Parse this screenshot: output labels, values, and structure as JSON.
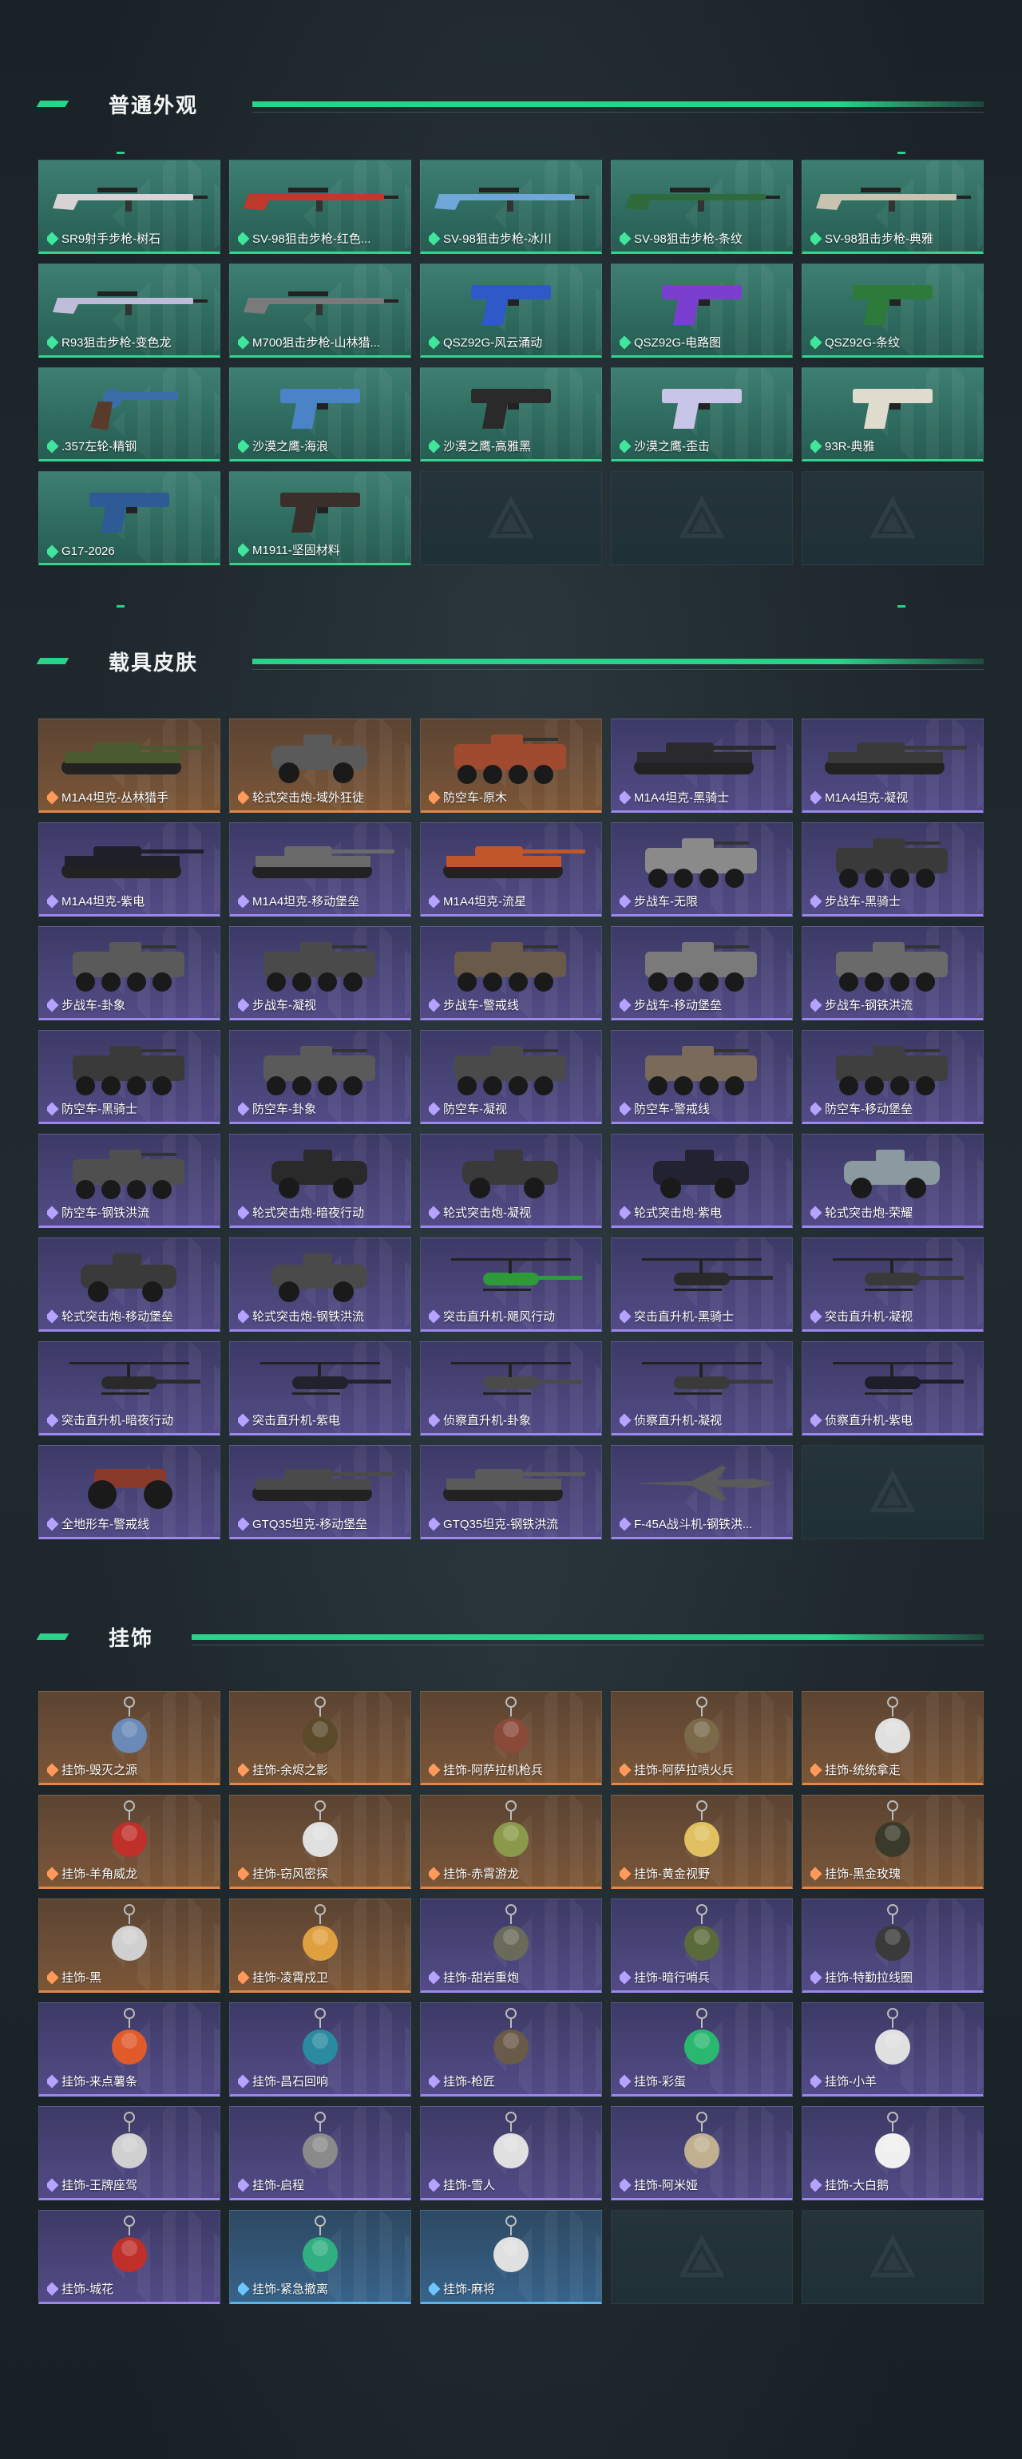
{
  "sections": {
    "appearance": {
      "title": "普通外观",
      "items": [
        {
          "label": "SR9射手步枪-树石",
          "rarity": "green",
          "kind": "rifle",
          "color": "#d9d2d4"
        },
        {
          "label": "SV-98狙击步枪-红色...",
          "rarity": "green",
          "kind": "rifle",
          "color": "#c0392b"
        },
        {
          "label": "SV-98狙击步枪-冰川",
          "rarity": "green",
          "kind": "rifle",
          "color": "#6ea6d8"
        },
        {
          "label": "SV-98狙击步枪-条纹",
          "rarity": "green",
          "kind": "rifle",
          "color": "#2f6b3a"
        },
        {
          "label": "SV-98狙击步枪-典雅",
          "rarity": "green",
          "kind": "rifle",
          "color": "#c9c2b0"
        },
        {
          "label": "R93狙击步枪-变色龙",
          "rarity": "green",
          "kind": "rifle",
          "color": "#bfbcd9"
        },
        {
          "label": "M700狙击步枪-山林猎...",
          "rarity": "green",
          "kind": "rifle",
          "color": "#7a7a7a"
        },
        {
          "label": "QSZ92G-风云涌动",
          "rarity": "green",
          "kind": "pistol",
          "color": "#2f58c8"
        },
        {
          "label": "QSZ92G-电路图",
          "rarity": "green",
          "kind": "pistol",
          "color": "#7b3fd0"
        },
        {
          "label": "QSZ92G-条纹",
          "rarity": "green",
          "kind": "pistol",
          "color": "#2e7a3a"
        },
        {
          "label": ".357左轮-精钢",
          "rarity": "green",
          "kind": "revolver",
          "color": "#3b6ea8"
        },
        {
          "label": "沙漠之鹰-海浪",
          "rarity": "green",
          "kind": "pistol",
          "color": "#4b83c8"
        },
        {
          "label": "沙漠之鹰-高雅黑",
          "rarity": "green",
          "kind": "pistol",
          "color": "#2a2a2a"
        },
        {
          "label": "沙漠之鹰-歪击",
          "rarity": "green",
          "kind": "pistol",
          "color": "#c8c6e8"
        },
        {
          "label": "93R-典雅",
          "rarity": "green",
          "kind": "pistol",
          "color": "#e0dccd"
        },
        {
          "label": "G17-2026",
          "rarity": "green",
          "kind": "pistol",
          "color": "#2e5a96"
        },
        {
          "label": "M1911-坚固材料",
          "rarity": "green",
          "kind": "pistol",
          "color": "#3a2f2a"
        },
        {
          "label": "",
          "rarity": "empty"
        },
        {
          "label": "",
          "rarity": "empty"
        },
        {
          "label": "",
          "rarity": "empty"
        }
      ]
    },
    "vehicles": {
      "title": "载具皮肤",
      "items": [
        {
          "label": "M1A4坦克-丛林猎手",
          "rarity": "orange",
          "kind": "tank",
          "color": "#4c5a32"
        },
        {
          "label": "轮式突击炮-域外狂徒",
          "rarity": "orange",
          "kind": "armored",
          "color": "#5a5a5a"
        },
        {
          "label": "防空车-原木",
          "rarity": "orange",
          "kind": "apc",
          "color": "#a04a30"
        },
        {
          "label": "M1A4坦克-黑骑士",
          "rarity": "purple",
          "kind": "tank",
          "color": "#2a2a2e"
        },
        {
          "label": "M1A4坦克-凝视",
          "rarity": "purple",
          "kind": "tank",
          "color": "#3a3a3a"
        },
        {
          "label": "M1A4坦克-紫电",
          "rarity": "purple",
          "kind": "tank",
          "color": "#1f1f2a"
        },
        {
          "label": "M1A4坦克-移动堡垒",
          "rarity": "purple",
          "kind": "tank",
          "color": "#6a6a6a"
        },
        {
          "label": "M1A4坦克-流星",
          "rarity": "purple",
          "kind": "tank",
          "color": "#c0562a"
        },
        {
          "label": "步战车-无限",
          "rarity": "purple",
          "kind": "apc",
          "color": "#8a8a8a"
        },
        {
          "label": "步战车-黑骑士",
          "rarity": "purple",
          "kind": "apc",
          "color": "#3a3a3a"
        },
        {
          "label": "步战车-卦象",
          "rarity": "purple",
          "kind": "apc",
          "color": "#5a5a5a"
        },
        {
          "label": "步战车-凝视",
          "rarity": "purple",
          "kind": "apc",
          "color": "#4a4a4a"
        },
        {
          "label": "步战车-警戒线",
          "rarity": "purple",
          "kind": "apc",
          "color": "#6a5a4a"
        },
        {
          "label": "步战车-移动堡垒",
          "rarity": "purple",
          "kind": "apc",
          "color": "#7a7a7a"
        },
        {
          "label": "步战车-钢铁洪流",
          "rarity": "purple",
          "kind": "apc",
          "color": "#6a6a6a"
        },
        {
          "label": "防空车-黑骑士",
          "rarity": "purple",
          "kind": "apc",
          "color": "#3a3a3a"
        },
        {
          "label": "防空车-卦象",
          "rarity": "purple",
          "kind": "apc",
          "color": "#5a5a5a"
        },
        {
          "label": "防空车-凝视",
          "rarity": "purple",
          "kind": "apc",
          "color": "#4a4a4a"
        },
        {
          "label": "防空车-警戒线",
          "rarity": "purple",
          "kind": "apc",
          "color": "#7a6a5a"
        },
        {
          "label": "防空车-移动堡垒",
          "rarity": "purple",
          "kind": "apc",
          "color": "#3f3f3f"
        },
        {
          "label": "防空车-钢铁洪流",
          "rarity": "purple",
          "kind": "apc",
          "color": "#4f4f4f"
        },
        {
          "label": "轮式突击炮-暗夜行动",
          "rarity": "purple",
          "kind": "armored",
          "color": "#2a2a2a"
        },
        {
          "label": "轮式突击炮-凝视",
          "rarity": "purple",
          "kind": "armored",
          "color": "#3a3a3a"
        },
        {
          "label": "轮式突击炮-紫电",
          "rarity": "purple",
          "kind": "armored",
          "color": "#222230"
        },
        {
          "label": "轮式突击炮-荣耀",
          "rarity": "purple",
          "kind": "armored",
          "color": "#8a9aa0"
        },
        {
          "label": "轮式突击炮-移动堡垒",
          "rarity": "purple",
          "kind": "armored",
          "color": "#3a3a3a"
        },
        {
          "label": "轮式突击炮-钢铁洪流",
          "rarity": "purple",
          "kind": "armored",
          "color": "#4a4a4a"
        },
        {
          "label": "突击直升机-飓风行动",
          "rarity": "purple",
          "kind": "heli",
          "color": "#2e9a3a"
        },
        {
          "label": "突击直升机-黑骑士",
          "rarity": "purple",
          "kind": "heli",
          "color": "#2a2a2a"
        },
        {
          "label": "突击直升机-凝视",
          "rarity": "purple",
          "kind": "heli",
          "color": "#3a3a3a"
        },
        {
          "label": "突击直升机-暗夜行动",
          "rarity": "purple",
          "kind": "heli",
          "color": "#2a2a2a"
        },
        {
          "label": "突击直升机-紫电",
          "rarity": "purple",
          "kind": "heli",
          "color": "#22222e"
        },
        {
          "label": "侦察直升机-卦象",
          "rarity": "purple",
          "kind": "heli",
          "color": "#4a4a4a"
        },
        {
          "label": "侦察直升机-凝视",
          "rarity": "purple",
          "kind": "heli",
          "color": "#3a3a3a"
        },
        {
          "label": "侦察直升机-紫电",
          "rarity": "purple",
          "kind": "heli",
          "color": "#1e1e2a"
        },
        {
          "label": "全地形车-警戒线",
          "rarity": "purple",
          "kind": "atv",
          "color": "#8a3a2a"
        },
        {
          "label": "GTQ35坦克-移动堡垒",
          "rarity": "purple",
          "kind": "tank",
          "color": "#4a4a4a"
        },
        {
          "label": "GTQ35坦克-钢铁洪流",
          "rarity": "purple",
          "kind": "tank",
          "color": "#5a5a5a"
        },
        {
          "label": "F-45A战斗机-钢铁洪...",
          "rarity": "purple",
          "kind": "jet",
          "color": "#5a5a5a"
        },
        {
          "label": "",
          "rarity": "empty"
        }
      ]
    },
    "charms": {
      "title": "挂饰",
      "items": [
        {
          "label": "挂饰-毁灭之源",
          "rarity": "orange",
          "kind": "charm",
          "color": "#6a8ab8"
        },
        {
          "label": "挂饰-余烬之影",
          "rarity": "orange",
          "kind": "charm",
          "color": "#5a4a2a"
        },
        {
          "label": "挂饰-阿萨拉机枪兵",
          "rarity": "orange",
          "kind": "charm",
          "color": "#8a4a3a"
        },
        {
          "label": "挂饰-阿萨拉喷火兵",
          "rarity": "orange",
          "kind": "charm",
          "color": "#7a6a4a"
        },
        {
          "label": "挂饰-统统拿走",
          "rarity": "orange",
          "kind": "charm",
          "color": "#e0e0e0"
        },
        {
          "label": "挂饰-羊角威龙",
          "rarity": "orange",
          "kind": "charm",
          "color": "#c0302a"
        },
        {
          "label": "挂饰-窃风密探",
          "rarity": "orange",
          "kind": "charm",
          "color": "#e0e0e0"
        },
        {
          "label": "挂饰-赤霄游龙",
          "rarity": "orange",
          "kind": "charm",
          "color": "#8a9a4a"
        },
        {
          "label": "挂饰-黄金视野",
          "rarity": "orange",
          "kind": "charm",
          "color": "#e0c060"
        },
        {
          "label": "挂饰-黑金玫瑰",
          "rarity": "orange",
          "kind": "charm",
          "color": "#3a3a2a"
        },
        {
          "label": "挂饰-黑",
          "rarity": "orange",
          "kind": "charm",
          "color": "#d0d0d0"
        },
        {
          "label": "挂饰-凌霄戍卫",
          "rarity": "orange",
          "kind": "charm",
          "color": "#e0a040"
        },
        {
          "label": "挂饰-甜岩重炮",
          "rarity": "purple",
          "kind": "charm",
          "color": "#6a6a5a"
        },
        {
          "label": "挂饰-暗行哨兵",
          "rarity": "purple",
          "kind": "charm",
          "color": "#5a6a3a"
        },
        {
          "label": "挂饰-特勤拉线圈",
          "rarity": "purple",
          "kind": "charm",
          "color": "#3a3a3a"
        },
        {
          "label": "挂饰-来点薯条",
          "rarity": "purple",
          "kind": "charm",
          "color": "#e05a2a"
        },
        {
          "label": "挂饰-昌石回响",
          "rarity": "purple",
          "kind": "charm",
          "color": "#2a8aa0"
        },
        {
          "label": "挂饰-枪匠",
          "rarity": "purple",
          "kind": "charm",
          "color": "#6a5a4a"
        },
        {
          "label": "挂饰-彩蛋",
          "rarity": "purple",
          "kind": "charm",
          "color": "#2ab870"
        },
        {
          "label": "挂饰-小羊",
          "rarity": "purple",
          "kind": "charm",
          "color": "#e0e0e0"
        },
        {
          "label": "挂饰-王牌座驾",
          "rarity": "purple",
          "kind": "charm",
          "color": "#d0d0d0"
        },
        {
          "label": "挂饰-启程",
          "rarity": "purple",
          "kind": "charm",
          "color": "#8a8a8a"
        },
        {
          "label": "挂饰-雪人",
          "rarity": "purple",
          "kind": "charm",
          "color": "#e0e0e0"
        },
        {
          "label": "挂饰-阿米娅",
          "rarity": "purple",
          "kind": "charm",
          "color": "#c0b090"
        },
        {
          "label": "挂饰-大白鹅",
          "rarity": "purple",
          "kind": "charm",
          "color": "#f0f0f0"
        },
        {
          "label": "挂饰-城花",
          "rarity": "purple",
          "kind": "charm",
          "color": "#c0302a"
        },
        {
          "label": "挂饰-紧急撤离",
          "rarity": "blue",
          "kind": "charm",
          "color": "#30b080"
        },
        {
          "label": "挂饰-麻将",
          "rarity": "blue",
          "kind": "charm",
          "color": "#e0e0e0"
        },
        {
          "label": "",
          "rarity": "empty"
        },
        {
          "label": "",
          "rarity": "empty"
        }
      ]
    }
  }
}
